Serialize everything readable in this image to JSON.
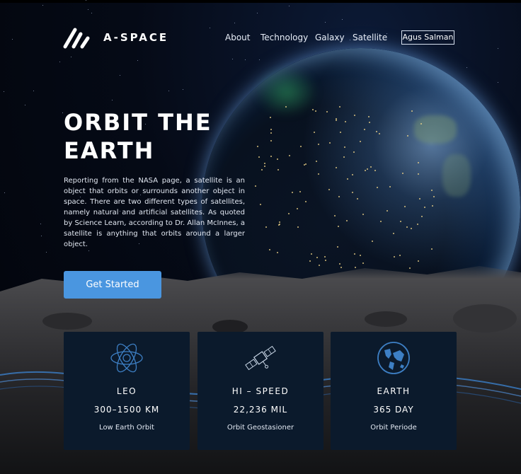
{
  "header": {
    "brand": "A-SPACE",
    "nav": [
      "About",
      "Technology",
      "Galaxy",
      "Satellite"
    ],
    "user_button": "Agus Salman"
  },
  "hero": {
    "title_line1": "ORBIT THE",
    "title_line2": "EARTH",
    "description": "Reporting from the NASA page, a satellite is an object that orbits or surrounds another object in space.  There are two different types of satellites, namely natural and artificial satellites.  As quoted by Science Learn, according to Dr. Allan McInnes, a satellite is anything that orbits around a larger object.",
    "cta_label": "Get Started"
  },
  "cards": [
    {
      "icon": "atom-orbit-icon",
      "title": "LEO",
      "value": "300–1500 KM",
      "caption": "Low Earth Orbit"
    },
    {
      "icon": "satellite-icon",
      "title": "HI – SPEED",
      "value": "22,236 MIL",
      "caption": "Orbit Geostasioner"
    },
    {
      "icon": "globe-icon",
      "title": "EARTH",
      "value": "365 DAY",
      "caption": "Orbit Periode"
    }
  ],
  "colors": {
    "accent": "#4a96e0",
    "card_bg": "#0b1a2c",
    "icon_stroke": "#3d7fc4"
  }
}
